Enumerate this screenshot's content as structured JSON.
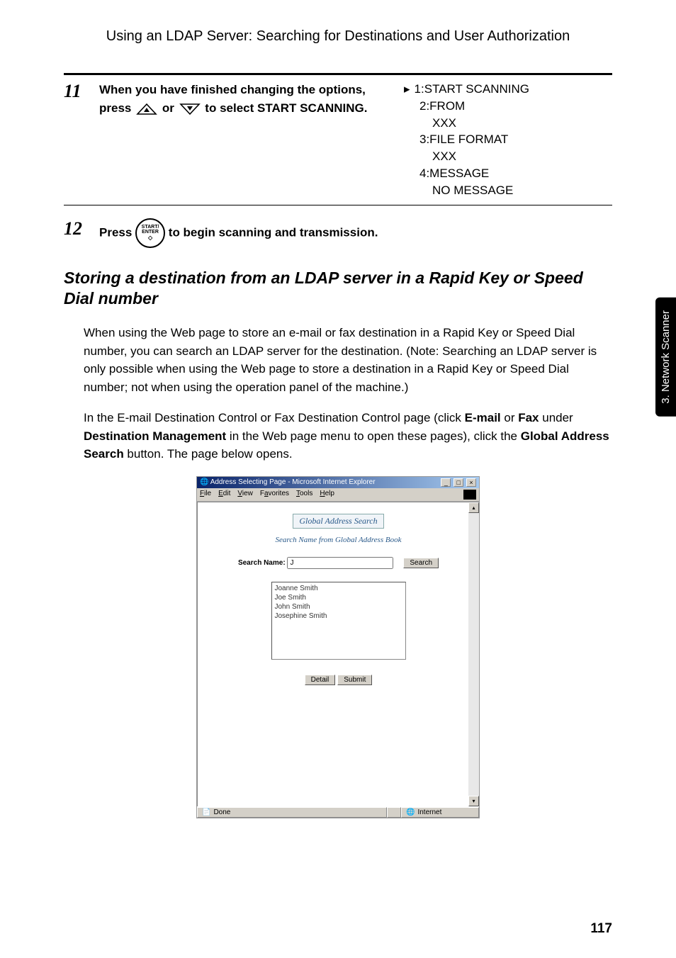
{
  "header": {
    "title": "Using an LDAP Server: Searching for Destinations and User Authorization"
  },
  "step11": {
    "number": "11",
    "text_part1": "When you have finished changing the options, press ",
    "text_part2": " or ",
    "text_part3": " to select START SCANNING.",
    "display": {
      "line1": "1:START SCANNING",
      "line2": "2:FROM",
      "line2b": "XXX",
      "line3": "3:FILE FORMAT",
      "line3b": "XXX",
      "line4": "4:MESSAGE",
      "line4b": "NO MESSAGE"
    }
  },
  "step12": {
    "number": "12",
    "text_before": "Press ",
    "key_top": "START/",
    "key_mid": "ENTER",
    "text_after": " to begin scanning and transmission."
  },
  "subheading": "Storing a destination from an LDAP server in a Rapid Key or Speed Dial number",
  "para1": "When using the Web page to store an e-mail or fax destination in a Rapid Key or Speed Dial number, you can search an LDAP server for the destination. (Note: Searching an LDAP server is only possible when using the Web page to store a destination in a Rapid Key or Speed Dial number; not when using the operation panel of the machine.)",
  "para2_a": " In the E-mail Destination Control or Fax Destination Control page (click ",
  "para2_b": "E-mail",
  "para2_c": " or ",
  "para2_d": "Fax",
  "para2_e": " under ",
  "para2_f": "Destination Management",
  "para2_g": " in the Web page menu to open these pages), click the ",
  "para2_h": "Global Address Search",
  "para2_i": " button. The page below opens.",
  "sidebar": "3. Network Scanner",
  "ie": {
    "title": "Address Selecting Page - Microsoft Internet Explorer",
    "menu": {
      "file": "File",
      "edit": "Edit",
      "view": "View",
      "favorites": "Favorites",
      "tools": "Tools",
      "help": "Help"
    },
    "heading": "Global Address Search",
    "sub": "Search Name from Global Address Book",
    "search_label": "Search Name:",
    "search_value": "J",
    "search_btn": "Search",
    "list": [
      "Joanne Smith",
      "Joe Smith",
      "John Smith",
      "Josephine Smith"
    ],
    "detail_btn": "Detail",
    "submit_btn": "Submit",
    "status_done": "Done",
    "status_zone": "Internet"
  },
  "page_number": "117"
}
